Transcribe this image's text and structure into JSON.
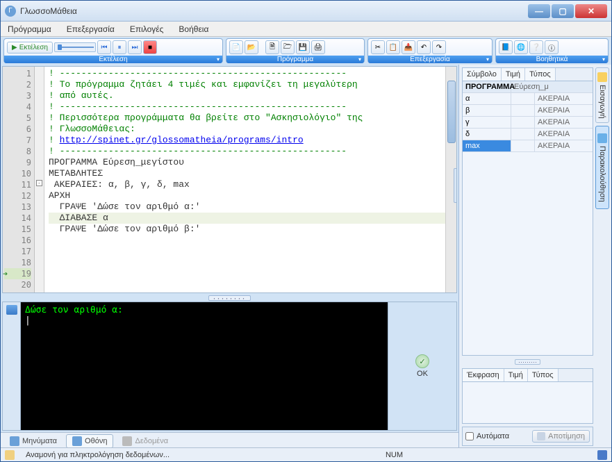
{
  "window": {
    "title": "ΓλωσσοΜάθεια"
  },
  "menu": {
    "program": "Πρόγραμμα",
    "edit": "Επεξεργασία",
    "options": "Επιλογές",
    "help": "Βοήθεια"
  },
  "toolbars": {
    "run": {
      "label": "Εκτέλεση",
      "run_label": "Εκτέλεση"
    },
    "program": {
      "label": "Πρόγραμμα"
    },
    "edit": {
      "label": "Επεξεργασία"
    },
    "help": {
      "label": "Βοηθητικά"
    }
  },
  "code": {
    "visible_start": 1,
    "visible_end": 20,
    "current_line": 19,
    "lines": [
      "! -----------------------------------------------------",
      "! Το πρόγραμμα ζητάει 4 τιμές και εμφανίζει τη μεγαλύτερη",
      "! από αυτές.",
      "! -----------------------------------------------------",
      "! Περισσότερα προγράμματα θα βρείτε στο \"Ασκησιολόγιο\" της",
      "! ΓλωσσοΜάθειας:",
      "! http://spinet.gr/glossomatheia/programs/intro",
      "! -----------------------------------------------------",
      "",
      "",
      "ΠΡΟΓΡΑΜΜΑ Εύρεση_μεγίστου",
      "",
      "ΜΕΤΑΒΛΗΤΕΣ",
      " ΑΚΕΡΑΙΕΣ: α, β, γ, δ, max",
      "",
      "ΑΡΧΗ",
      "",
      "  ΓΡΑΨΕ 'Δώσε τον αριθμό α:'",
      "  ΔΙΑΒΑΣΕ α",
      "  ΓΡΑΨΕ 'Δώσε τον αριθμό β:'"
    ],
    "link": "http://spinet.gr/glossomatheia/programs/intro"
  },
  "console": {
    "prompt": "Δώσε τον αριθμό α:",
    "cursor": "|",
    "ok_label": "OK"
  },
  "bottom_tabs": {
    "messages": "Μηνύματα",
    "screen": "Οθόνη",
    "data": "Δεδομένα"
  },
  "inspector": {
    "headers": {
      "symbol": "Σύμβολο",
      "value": "Τιμή",
      "type": "Τύπος"
    },
    "program_row": {
      "label": "ΠΡΟΓΡΑΜΜΑ",
      "name": "Εύρεση_μ"
    },
    "rows": [
      {
        "name": "α",
        "value": "",
        "type": "ΑΚΕΡΑΙΑ"
      },
      {
        "name": "β",
        "value": "",
        "type": "ΑΚΕΡΑΙΑ"
      },
      {
        "name": "γ",
        "value": "",
        "type": "ΑΚΕΡΑΙΑ"
      },
      {
        "name": "δ",
        "value": "",
        "type": "ΑΚΕΡΑΙΑ"
      },
      {
        "name": "max",
        "value": "",
        "type": "ΑΚΕΡΑΙΑ",
        "selected": true
      }
    ],
    "expr_headers": {
      "expr": "Έκφραση",
      "value": "Τιμή",
      "type": "Τύπος"
    },
    "auto_label": "Αυτόματα",
    "snapshot_label": "Αποτίμηση"
  },
  "side_tabs": {
    "insert": "Εισαγωγή",
    "watch": "Παρακολούθηση"
  },
  "status": {
    "text": "Αναμονή για πληκτρολόγηση δεδομένων...",
    "num": "NUM"
  }
}
